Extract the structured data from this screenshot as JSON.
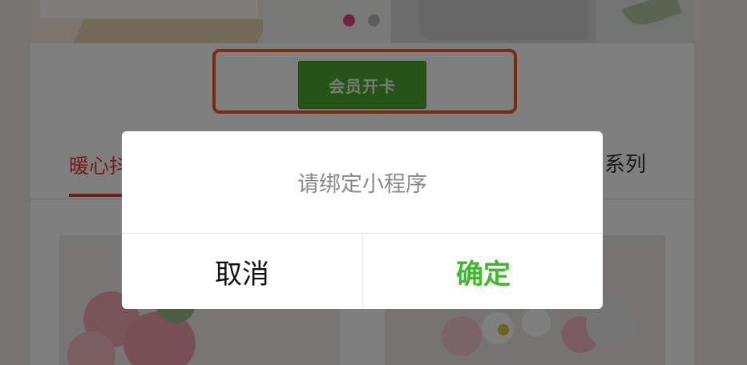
{
  "page": {
    "member_button_label": "会员开卡",
    "tabs": {
      "active_label": "暖心抖",
      "right_label": "川系列"
    },
    "banner": {
      "slides": 2,
      "active_index": 0
    }
  },
  "dialog": {
    "message": "请绑定小程序",
    "cancel_label": "取消",
    "confirm_label": "确定"
  },
  "colors": {
    "accent_red": "#e23b32",
    "confirm_green": "#3fb92b",
    "button_green": "#4ca82c",
    "highlight_orange": "#f05a22",
    "dot_active": "#e7418a"
  }
}
